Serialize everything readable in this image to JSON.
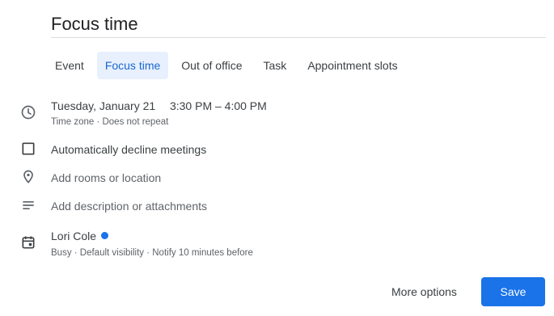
{
  "title": "Focus time",
  "tabs": [
    {
      "label": "Event"
    },
    {
      "label": "Focus time",
      "active": true
    },
    {
      "label": "Out of office"
    },
    {
      "label": "Task"
    },
    {
      "label": "Appointment slots"
    }
  ],
  "datetime": {
    "date": "Tuesday, January 21",
    "time": "3:30 PM – 4:00 PM",
    "details": "Time zone · Does not repeat"
  },
  "decline": {
    "label": "Automatically decline meetings",
    "checked": false
  },
  "location": {
    "placeholder": "Add rooms or location"
  },
  "description": {
    "placeholder": "Add description or attachments"
  },
  "calendar": {
    "owner": "Lori Cole",
    "dot_color": "#1a73e8",
    "details": "Busy · Default visibility · Notify 10 minutes before"
  },
  "actions": {
    "more_options": "More options",
    "save": "Save"
  },
  "colors": {
    "accent": "#1a73e8",
    "active_tab_bg": "#e8f0fe",
    "active_tab_text": "#1967d2"
  },
  "icons": [
    "clock-icon",
    "checkbox-icon",
    "location-pin-icon",
    "notes-icon",
    "calendar-icon"
  ]
}
